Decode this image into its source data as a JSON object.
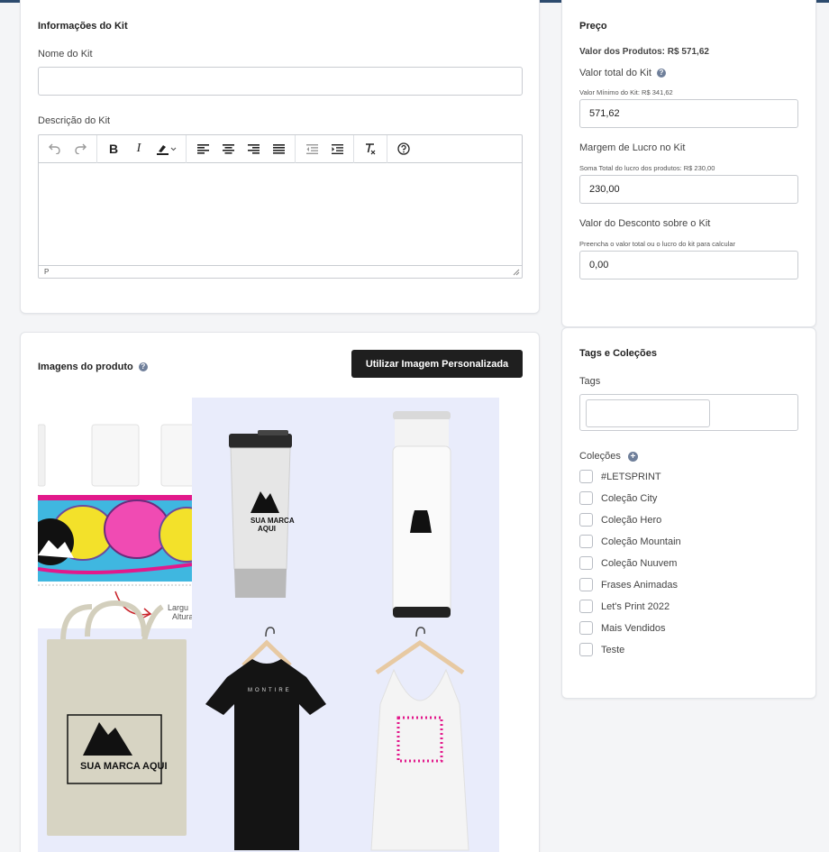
{
  "kit_info": {
    "title": "Informações do Kit",
    "name_label": "Nome do Kit",
    "name_value": "",
    "description_label": "Descrição do Kit",
    "editor_status": "P"
  },
  "editor_toolbar": {
    "icons": [
      "undo-icon",
      "redo-icon",
      "bold-icon",
      "italic-icon",
      "highlight-icon",
      "align-left-icon",
      "align-center-icon",
      "align-right-icon",
      "align-justify-icon",
      "outdent-icon",
      "indent-icon",
      "clear-format-icon",
      "help-icon"
    ]
  },
  "images": {
    "title": "Imagens do produto",
    "custom_button": "Utilizar Imagem Personalizada",
    "mockup_texts": {
      "brand": "SUA MARCA AQUI",
      "brand_short": "SUA MARCA",
      "brand_short2": "AQUI",
      "shirt_print": "MONTIRE",
      "dim_largura": "Largu",
      "dim_altura": "Altura"
    }
  },
  "price": {
    "title": "Preço",
    "products_value": "Valor dos Produtos: R$ 571,62",
    "total_label": "Valor total do Kit",
    "total_hint": "Valor Mínimo do Kit: R$ 341,62",
    "total_value": "571,62",
    "margin_label": "Margem de Lucro no Kit",
    "margin_hint": "Soma Total do lucro dos produtos: R$ 230,00",
    "margin_value": "230,00",
    "discount_label": "Valor do Desconto sobre o Kit",
    "discount_hint": "Preencha o valor total ou o lucro do kit para calcular",
    "discount_value": "0,00"
  },
  "tags": {
    "title": "Tags e Coleções",
    "tags_label": "Tags",
    "tags_value": "",
    "collections_label": "Coleções",
    "collections": [
      {
        "label": "#LETSPRINT",
        "checked": false
      },
      {
        "label": "Coleção City",
        "checked": false
      },
      {
        "label": "Coleção Hero",
        "checked": false
      },
      {
        "label": "Coleção Mountain",
        "checked": false
      },
      {
        "label": "Coleção Nuuvem",
        "checked": false
      },
      {
        "label": "Frases Animadas",
        "checked": false
      },
      {
        "label": "Let's Print 2022",
        "checked": false
      },
      {
        "label": "Mais Vendidos",
        "checked": false
      },
      {
        "label": "Teste",
        "checked": false
      }
    ]
  },
  "colors": {
    "accent": "#2d4b6e",
    "button_dark": "#1f1f1f",
    "mockup_bg": "#e9ecfb",
    "help_icon": "#6f7f9a"
  }
}
